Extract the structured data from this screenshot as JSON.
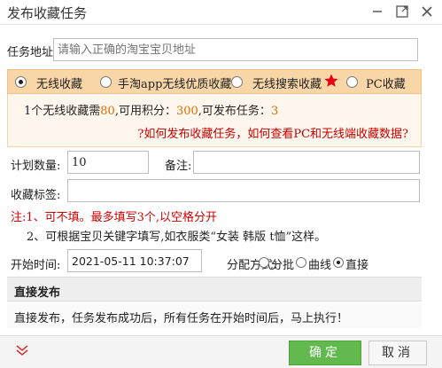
{
  "dialog": {
    "title": "发布收藏任务"
  },
  "task_address": {
    "label": "任务地址:",
    "placeholder": "请输入正确的淘宝宝贝地址"
  },
  "collect_types": {
    "options": [
      {
        "label": "无线收藏",
        "selected": true
      },
      {
        "label": "手淘app无线优质收藏",
        "selected": false
      },
      {
        "label": "无线搜索收藏",
        "selected": false,
        "hot_icon": "star-icon"
      },
      {
        "label": "PC收藏",
        "selected": false
      }
    ]
  },
  "info": {
    "prefix": "1个无线收藏需",
    "cost": "80",
    "mid": ",可用积分：",
    "points": "300",
    "mid2": ",可发布任务：",
    "tasks": "3",
    "help_link": "?如何发布收藏任务，如何查看PC和无线端收藏数据?"
  },
  "plan": {
    "label": "计划数量:",
    "value": "10",
    "remark_label": "备注:"
  },
  "tags": {
    "label": "收藏标签:"
  },
  "notes": {
    "line1": "注:1、可不填。最多填写3个,以空格分开",
    "line2": "2、可根据宝贝关键字填写,如衣服类“女装 韩版 t恤”这样。"
  },
  "schedule": {
    "label": "开始时间:",
    "value": "2021-05-11 10:37:07",
    "distribution_label": "分配方式：",
    "options": [
      {
        "label": "分批",
        "selected": false
      },
      {
        "label": "曲线",
        "selected": false
      },
      {
        "label": "直接",
        "selected": true
      }
    ]
  },
  "direct": {
    "heading": "直接发布",
    "description": "直接发布，任务发布成功后，所有任务在开始时间后，马上执行！"
  },
  "footer": {
    "ok_label": "确定",
    "cancel_label": "取消"
  },
  "colors": {
    "orange_bar": "#f9d6a7",
    "ok_button": "#62b94d",
    "warning_red": "#c90000",
    "points_orange": "#e06b00"
  }
}
